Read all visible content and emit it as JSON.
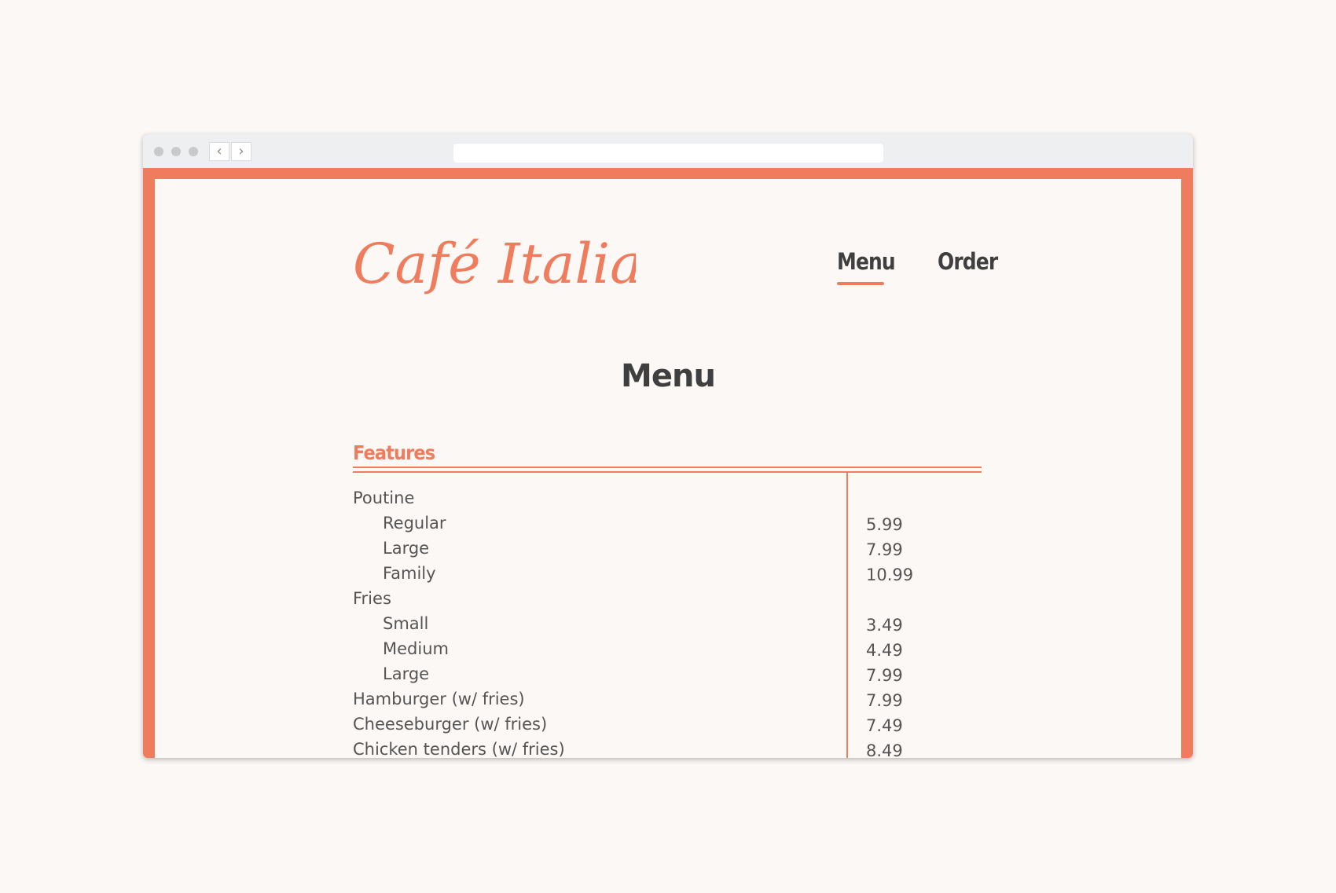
{
  "brand": {
    "name": "Café Italia",
    "color": "#f07c5e"
  },
  "browser": {
    "back_icon": "chevron-left-icon",
    "forward_icon": "chevron-right-icon",
    "back_glyph": "‹",
    "forward_glyph": "›"
  },
  "nav": {
    "items": [
      {
        "label": "Menu",
        "active": true
      },
      {
        "label": "Order",
        "active": false
      }
    ]
  },
  "page": {
    "title": "Menu"
  },
  "sections": [
    {
      "title": "Features",
      "items": [
        {
          "name": "Poutine",
          "price": "",
          "indent": false
        },
        {
          "name": "Regular",
          "price": "5.99",
          "indent": true
        },
        {
          "name": "Large",
          "price": "7.99",
          "indent": true
        },
        {
          "name": "Family",
          "price": "10.99",
          "indent": true
        },
        {
          "name": "Fries",
          "price": "",
          "indent": false
        },
        {
          "name": "Small",
          "price": "3.49",
          "indent": true
        },
        {
          "name": "Medium",
          "price": "4.49",
          "indent": true
        },
        {
          "name": "Large",
          "price": "7.99",
          "indent": true
        },
        {
          "name": "Hamburger (w/ fries)",
          "price": "7.99",
          "indent": false
        },
        {
          "name": "Cheeseburger (w/ fries)",
          "price": "7.49",
          "indent": false
        },
        {
          "name": "Chicken tenders (w/ fries)",
          "price": "8.49",
          "indent": false
        }
      ]
    }
  ]
}
